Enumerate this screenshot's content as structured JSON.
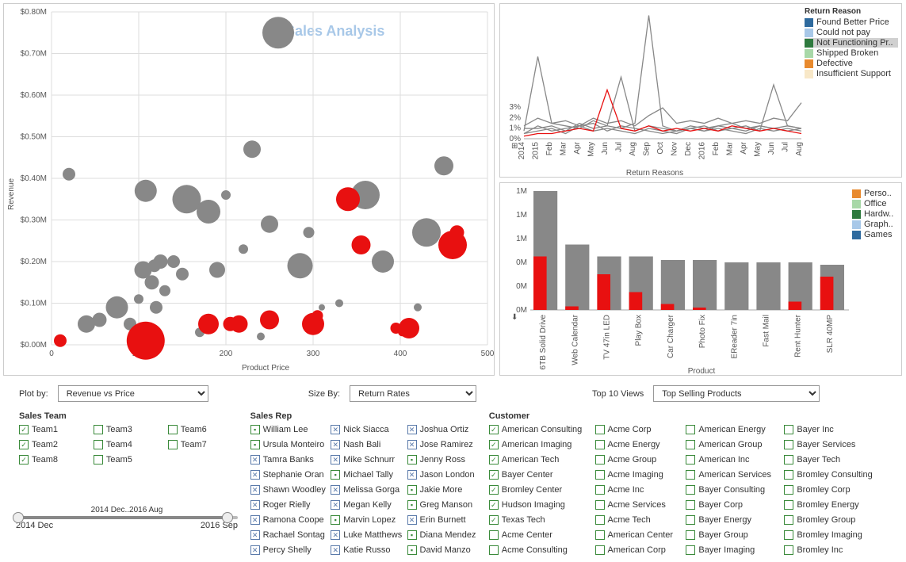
{
  "chart_data": [
    {
      "type": "scatter",
      "title": "Sales Analysis",
      "xlabel": "Product Price",
      "ylabel": "Revenue",
      "xlim": [
        0,
        500
      ],
      "ylim": [
        0,
        0.8
      ],
      "y_unit": "M",
      "x_ticks": [
        0,
        100,
        200,
        300,
        400,
        500
      ],
      "y_ticks": [
        "$0.00M",
        "$0.10M",
        "$0.20M",
        "$0.30M",
        "$0.40M",
        "$0.50M",
        "$0.60M",
        "$0.70M",
        "$0.80M"
      ],
      "series": [
        {
          "name": "grey",
          "points": [
            {
              "x": 20,
              "y": 0.41,
              "r": 8
            },
            {
              "x": 40,
              "y": 0.05,
              "r": 11
            },
            {
              "x": 55,
              "y": 0.06,
              "r": 9
            },
            {
              "x": 75,
              "y": 0.09,
              "r": 14
            },
            {
              "x": 90,
              "y": 0.05,
              "r": 8
            },
            {
              "x": 100,
              "y": 0.11,
              "r": 6
            },
            {
              "x": 105,
              "y": 0.18,
              "r": 11
            },
            {
              "x": 108,
              "y": 0.37,
              "r": 14
            },
            {
              "x": 115,
              "y": 0.15,
              "r": 9
            },
            {
              "x": 118,
              "y": 0.19,
              "r": 8
            },
            {
              "x": 120,
              "y": 0.09,
              "r": 8
            },
            {
              "x": 125,
              "y": 0.2,
              "r": 9
            },
            {
              "x": 130,
              "y": 0.13,
              "r": 7
            },
            {
              "x": 140,
              "y": 0.2,
              "r": 8
            },
            {
              "x": 150,
              "y": 0.17,
              "r": 8
            },
            {
              "x": 155,
              "y": 0.35,
              "r": 18
            },
            {
              "x": 170,
              "y": 0.03,
              "r": 6
            },
            {
              "x": 180,
              "y": 0.32,
              "r": 15
            },
            {
              "x": 190,
              "y": 0.18,
              "r": 10
            },
            {
              "x": 200,
              "y": 0.36,
              "r": 6
            },
            {
              "x": 220,
              "y": 0.23,
              "r": 6
            },
            {
              "x": 230,
              "y": 0.47,
              "r": 11
            },
            {
              "x": 240,
              "y": 0.02,
              "r": 5
            },
            {
              "x": 250,
              "y": 0.29,
              "r": 11
            },
            {
              "x": 260,
              "y": 0.75,
              "r": 20
            },
            {
              "x": 285,
              "y": 0.19,
              "r": 16
            },
            {
              "x": 295,
              "y": 0.27,
              "r": 7
            },
            {
              "x": 310,
              "y": 0.09,
              "r": 4
            },
            {
              "x": 330,
              "y": 0.1,
              "r": 5
            },
            {
              "x": 360,
              "y": 0.36,
              "r": 18
            },
            {
              "x": 380,
              "y": 0.2,
              "r": 14
            },
            {
              "x": 420,
              "y": 0.09,
              "r": 5
            },
            {
              "x": 430,
              "y": 0.27,
              "r": 18
            },
            {
              "x": 450,
              "y": 0.43,
              "r": 12
            }
          ]
        },
        {
          "name": "red",
          "points": [
            {
              "x": 10,
              "y": 0.01,
              "r": 8
            },
            {
              "x": 108,
              "y": 0.01,
              "r": 24
            },
            {
              "x": 180,
              "y": 0.05,
              "r": 13
            },
            {
              "x": 205,
              "y": 0.05,
              "r": 9
            },
            {
              "x": 215,
              "y": 0.05,
              "r": 11
            },
            {
              "x": 250,
              "y": 0.06,
              "r": 12
            },
            {
              "x": 300,
              "y": 0.05,
              "r": 14
            },
            {
              "x": 305,
              "y": 0.07,
              "r": 7
            },
            {
              "x": 340,
              "y": 0.35,
              "r": 15
            },
            {
              "x": 355,
              "y": 0.24,
              "r": 12
            },
            {
              "x": 395,
              "y": 0.04,
              "r": 7
            },
            {
              "x": 402,
              "y": 0.03,
              "r": 5
            },
            {
              "x": 410,
              "y": 0.04,
              "r": 13
            },
            {
              "x": 460,
              "y": 0.24,
              "r": 18
            },
            {
              "x": 465,
              "y": 0.27,
              "r": 9
            }
          ]
        }
      ]
    },
    {
      "type": "line",
      "xlabel": "Return Reasons",
      "ylabel": "",
      "y_ticks": [
        "0%",
        "1%",
        "2%",
        "3%"
      ],
      "x_ticks": [
        "2014",
        "2015",
        "Feb",
        "Mar",
        "Apr",
        "May",
        "Jun",
        "Jul",
        "Aug",
        "Sep",
        "Oct",
        "Nov",
        "Dec",
        "2016",
        "Feb",
        "Mar",
        "Apr",
        "May",
        "Jun",
        "Jul",
        "Aug"
      ],
      "legend_title": "Return Reason",
      "legend": [
        {
          "label": "Found Better Price",
          "color": "#2e6a9e"
        },
        {
          "label": "Could not pay",
          "color": "#a8c8e8"
        },
        {
          "label": "Not Functioning Pr..",
          "color": "#2e7a3e"
        },
        {
          "label": "Shipped Broken",
          "color": "#a8d8a8"
        },
        {
          "label": "Defective",
          "color": "#e88a2e"
        },
        {
          "label": "Insufficient Support",
          "color": "#f8e8c8"
        }
      ],
      "series": [
        {
          "name": "g1",
          "values": [
            0.2,
            0.5,
            0.3,
            0.4,
            0.5,
            0.6,
            0.3,
            0.5,
            0.4,
            0.3,
            0.2,
            0.3,
            0.4,
            0.3,
            0.5,
            0.4,
            0.3,
            0.5,
            0.4,
            0.3,
            0.4
          ]
        },
        {
          "name": "g2",
          "values": [
            0.3,
            3.2,
            0.6,
            0.5,
            0.4,
            0.7,
            0.5,
            0.4,
            0.6,
            4.8,
            0.5,
            0.3,
            0.5,
            0.4,
            0.5,
            0.6,
            0.4,
            0.5,
            0.4,
            0.5,
            0.4
          ]
        },
        {
          "name": "g3",
          "values": [
            0.4,
            0.4,
            0.5,
            0.3,
            0.6,
            0.4,
            0.5,
            2.4,
            0.3,
            0.5,
            0.4,
            0.3,
            0.4,
            0.5,
            0.3,
            0.4,
            0.5,
            0.3,
            2.1,
            0.5,
            0.4
          ]
        },
        {
          "name": "g4",
          "values": [
            0.2,
            0.3,
            0.4,
            0.2,
            0.5,
            0.3,
            0.4,
            0.3,
            0.2,
            0.4,
            0.3,
            0.2,
            0.4,
            0.3,
            0.4,
            0.3,
            0.2,
            0.4,
            0.3,
            0.4,
            0.3
          ]
        },
        {
          "name": "g5",
          "values": [
            0.5,
            0.8,
            0.6,
            0.7,
            0.5,
            0.8,
            0.6,
            0.7,
            0.5,
            0.9,
            1.2,
            0.6,
            0.7,
            0.6,
            0.8,
            0.6,
            0.7,
            0.6,
            0.8,
            0.7,
            1.4
          ]
        },
        {
          "name": "red",
          "values": [
            0.1,
            0.2,
            0.2,
            0.3,
            0.4,
            0.3,
            1.9,
            0.4,
            0.3,
            0.5,
            0.3,
            0.4,
            0.3,
            0.4,
            0.3,
            0.5,
            0.4,
            0.3,
            0.4,
            0.3,
            0.2
          ]
        }
      ]
    },
    {
      "type": "bar",
      "xlabel": "Product",
      "ylabel": "",
      "y_ticks": [
        "0M",
        "0M",
        "0M",
        "1M",
        "1M",
        "1M"
      ],
      "categories": [
        "6TB Solid Drive",
        "Web Calendar",
        "TV 47in LED",
        "Play Box",
        "Car Charger",
        "Photo Fix",
        "EReader 7in",
        "Fast Mail",
        "Rent Hunter",
        "SLR 40MP"
      ],
      "series": [
        {
          "name": "grey",
          "values": [
            1.0,
            0.55,
            0.45,
            0.45,
            0.42,
            0.42,
            0.4,
            0.4,
            0.4,
            0.38
          ]
        },
        {
          "name": "red",
          "values": [
            0.45,
            0.03,
            0.3,
            0.15,
            0.05,
            0.02,
            0,
            0,
            0.07,
            0.28
          ]
        }
      ],
      "legend": [
        {
          "label": "Perso..",
          "color": "#e88a2e"
        },
        {
          "label": "Office",
          "color": "#a8d8a8"
        },
        {
          "label": "Hardw..",
          "color": "#2e7a3e"
        },
        {
          "label": "Graph..",
          "color": "#a8c8e8"
        },
        {
          "label": "Games",
          "color": "#2e6a9e"
        }
      ]
    }
  ],
  "controls": {
    "plot_by_label": "Plot by:",
    "plot_by_value": "Revenue vs Price",
    "size_by_label": "Size By:",
    "size_by_value": "Return Rates",
    "top10_label": "Top 10 Views",
    "top10_value": "Top Selling Products"
  },
  "filters": {
    "sales_team": {
      "title": "Sales Team",
      "items": [
        {
          "label": "Team1",
          "checked": true
        },
        {
          "label": "Team2",
          "checked": true
        },
        {
          "label": "Team8",
          "checked": true
        },
        {
          "label": "Team3",
          "checked": false
        },
        {
          "label": "Team4",
          "checked": false
        },
        {
          "label": "Team5",
          "checked": false
        },
        {
          "label": "Team6",
          "checked": false
        },
        {
          "label": "Team7",
          "checked": false
        }
      ]
    },
    "sales_rep": {
      "title": "Sales Rep",
      "items": [
        {
          "label": "William Lee",
          "s": "g"
        },
        {
          "label": "Ursula Monteiro",
          "s": "g"
        },
        {
          "label": "Tamra Banks",
          "s": "x"
        },
        {
          "label": "Stephanie Oran",
          "s": "x"
        },
        {
          "label": "Shawn Woodley",
          "s": "x"
        },
        {
          "label": "Roger Rielly",
          "s": "x"
        },
        {
          "label": "Ramona Coope",
          "s": "x"
        },
        {
          "label": "Rachael Sontag",
          "s": "x"
        },
        {
          "label": "Percy Shelly",
          "s": "x"
        },
        {
          "label": "Nick Siacca",
          "s": "x"
        },
        {
          "label": "Nash Bali",
          "s": "x"
        },
        {
          "label": "Mike Schnurr",
          "s": "x"
        },
        {
          "label": "Michael Tally",
          "s": "g"
        },
        {
          "label": "Melissa Gorga",
          "s": "x"
        },
        {
          "label": "Megan Kelly",
          "s": "x"
        },
        {
          "label": "Marvin Lopez",
          "s": "g"
        },
        {
          "label": "Luke Matthews",
          "s": "x"
        },
        {
          "label": "Katie Russo",
          "s": "x"
        },
        {
          "label": "Joshua Ortiz",
          "s": "x"
        },
        {
          "label": "Jose Ramirez",
          "s": "x"
        },
        {
          "label": "Jenny Ross",
          "s": "g"
        },
        {
          "label": "Jason London",
          "s": "x"
        },
        {
          "label": "Jakie More",
          "s": "g"
        },
        {
          "label": "Greg Manson",
          "s": "g"
        },
        {
          "label": "Erin Burnett",
          "s": "x"
        },
        {
          "label": "Diana Mendez",
          "s": "g"
        },
        {
          "label": "David Manzo",
          "s": "g"
        }
      ]
    },
    "customer": {
      "title": "Customer",
      "items": [
        {
          "label": "American Consulting",
          "c": true
        },
        {
          "label": "American Imaging",
          "c": true
        },
        {
          "label": "American Tech",
          "c": true
        },
        {
          "label": "Bayer Center",
          "c": true
        },
        {
          "label": "Bromley Center",
          "c": true
        },
        {
          "label": "Hudson Imaging",
          "c": true
        },
        {
          "label": "Texas Tech",
          "c": true
        },
        {
          "label": "Acme Center",
          "c": false
        },
        {
          "label": "Acme Consulting",
          "c": false
        },
        {
          "label": "Acme Corp",
          "c": false
        },
        {
          "label": "Acme Energy",
          "c": false
        },
        {
          "label": "Acme Group",
          "c": false
        },
        {
          "label": "Acme Imaging",
          "c": false
        },
        {
          "label": "Acme Inc",
          "c": false
        },
        {
          "label": "Acme Services",
          "c": false
        },
        {
          "label": "Acme Tech",
          "c": false
        },
        {
          "label": "American Center",
          "c": false
        },
        {
          "label": "American Corp",
          "c": false
        },
        {
          "label": "American Energy",
          "c": false
        },
        {
          "label": "American Group",
          "c": false
        },
        {
          "label": "American Inc",
          "c": false
        },
        {
          "label": "American Services",
          "c": false
        },
        {
          "label": "Bayer Consulting",
          "c": false
        },
        {
          "label": "Bayer Corp",
          "c": false
        },
        {
          "label": "Bayer Energy",
          "c": false
        },
        {
          "label": "Bayer Group",
          "c": false
        },
        {
          "label": "Bayer Imaging",
          "c": false
        },
        {
          "label": "Bayer Inc",
          "c": false
        },
        {
          "label": "Bayer Services",
          "c": false
        },
        {
          "label": "Bayer Tech",
          "c": false
        },
        {
          "label": "Bromley Consulting",
          "c": false
        },
        {
          "label": "Bromley Corp",
          "c": false
        },
        {
          "label": "Bromley Energy",
          "c": false
        },
        {
          "label": "Bromley Group",
          "c": false
        },
        {
          "label": "Bromley Imaging",
          "c": false
        },
        {
          "label": "Bromley Inc",
          "c": false
        }
      ]
    }
  },
  "slider": {
    "range_label": "2014 Dec..2016 Aug",
    "start": "2014 Dec",
    "end": "2016 Sep"
  }
}
